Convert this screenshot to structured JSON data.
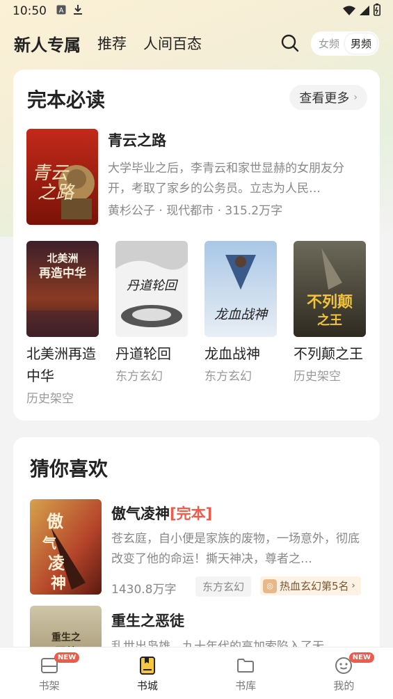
{
  "status_bar": {
    "time": "10:50",
    "icons": [
      "a-icon",
      "download-icon"
    ],
    "right_icons": [
      "wifi-icon",
      "signal-icon",
      "battery-icon"
    ]
  },
  "top_nav": {
    "tabs": [
      {
        "label": "新人专属",
        "active": true
      },
      {
        "label": "推荐",
        "active": false
      },
      {
        "label": "人间百态",
        "active": false
      }
    ],
    "gender_options": [
      "女频",
      "男频"
    ],
    "gender_selected": "男频"
  },
  "section_complete": {
    "title": "完本必读",
    "more_label": "查看更多",
    "featured": {
      "title": "青云之路",
      "description": "大学毕业之后，李青云和家世显赫的女朋友分开，考取了家乡的公务员。立志为人民…",
      "author": "黄杉公子",
      "category": "现代都市",
      "words": "315.2万字",
      "meta": "黄杉公子 · 现代都市 · 315.2万字",
      "cover_text": "青云之路"
    },
    "books": [
      {
        "title": "北美洲再造中华",
        "category": "历史架空",
        "cover_text": "北美洲再造中华",
        "cover_color": "#5a2a1e"
      },
      {
        "title": "丹道轮回",
        "category": "东方玄幻",
        "cover_text": "丹道轮回",
        "cover_color": "#e9e9e9"
      },
      {
        "title": "龙血战神",
        "category": "东方玄幻",
        "cover_text": "龙血战神",
        "cover_color": "#5c7fb0"
      },
      {
        "title": "不列颠之王",
        "category": "历史架空",
        "cover_text": "不列颠之王",
        "cover_color": "#4a4636"
      }
    ]
  },
  "section_guess": {
    "title": "猜你喜欢",
    "items": [
      {
        "title": "傲气凌神",
        "tag": "[完本]",
        "description": "苍玄庭，自小便是家族的废物，一场意外，彻底改变了他的命运！撕天神决，尊者之…",
        "words": "1430.8万字",
        "category": "东方玄幻",
        "rank": "热血玄幻第5名",
        "cover_text": "傲气凌神"
      },
      {
        "title": "重生之恶徒",
        "description": "乱世出枭雄，九十年代的高加索陷入了无…",
        "cover_text": "重生之恶徒"
      }
    ]
  },
  "bottom_nav": {
    "items": [
      {
        "label": "书架",
        "badge": "NEW",
        "active": false
      },
      {
        "label": "书城",
        "badge": "",
        "active": true
      },
      {
        "label": "书库",
        "badge": "",
        "active": false
      },
      {
        "label": "我的",
        "badge": "NEW",
        "active": false
      }
    ]
  },
  "colors": {
    "accent": "#f05a4b",
    "active_nav": "#f5c842"
  }
}
